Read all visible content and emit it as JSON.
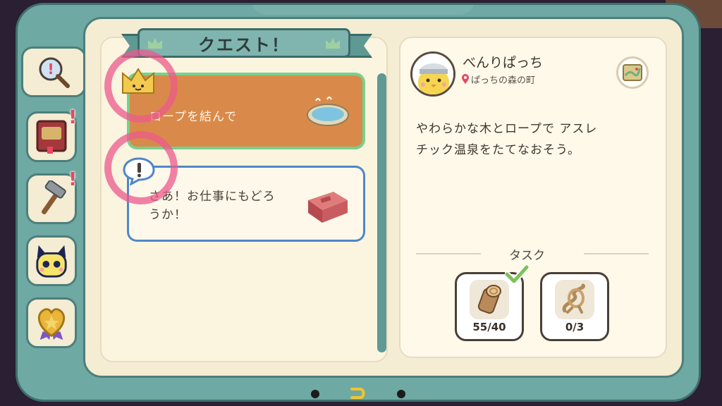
{
  "screen": {
    "title": "クエスト！"
  },
  "side_tabs": [
    {
      "name": "quest",
      "icon": "magnifier-alert-icon",
      "active": true,
      "has_alert": false
    },
    {
      "name": "journal",
      "icon": "book-icon",
      "active": false,
      "has_alert": true
    },
    {
      "name": "crafting",
      "icon": "hammer-icon",
      "active": false,
      "has_alert": true
    },
    {
      "name": "character",
      "icon": "tamagotchi-face-icon",
      "active": false,
      "has_alert": false
    },
    {
      "name": "achievements",
      "icon": "heart-medal-icon",
      "active": false,
      "has_alert": false
    }
  ],
  "quests": [
    {
      "label": "ロープを結んで",
      "badge": "crown-icon",
      "image": "hot-spring-icon",
      "selected": true
    },
    {
      "label_line1": "さあ！お仕事にもどろ",
      "label_line2": "うか！",
      "badge": "exclamation-bubble-icon",
      "image": "brick-icon",
      "selected": false
    }
  ],
  "detail": {
    "npc_name": "べんりぱっち",
    "location": "ぱっちの森の町",
    "description_line1": "やわらかな木とロープで アスレ",
    "description_line2": "チック温泉をたてなおそう。",
    "tasks_header": "タスク",
    "tasks": [
      {
        "item": "log-icon",
        "count": "55/40",
        "complete": true
      },
      {
        "item": "rope-icon",
        "count": "0/3",
        "complete": false
      }
    ]
  },
  "colors": {
    "frame": "#6fa9a3",
    "selected_quest": "#d98a4a",
    "selected_border": "#79d08c",
    "unselected_border": "#4f87c9",
    "highlight_ring": "#ec5a8c",
    "alert": "#e8475f",
    "back_arrow": "#f2c42e"
  }
}
